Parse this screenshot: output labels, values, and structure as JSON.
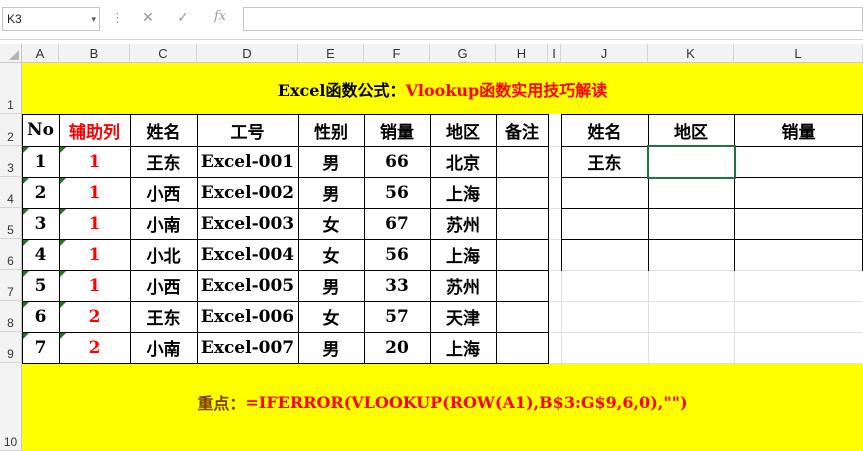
{
  "formula_bar": {
    "name_box": "K3",
    "menu_glyph": "⋮",
    "cancel_glyph": "✕",
    "enter_glyph": "✓",
    "fx_glyph": "fx",
    "dropdown_glyph": "▾"
  },
  "columns": [
    "A",
    "B",
    "C",
    "D",
    "E",
    "F",
    "G",
    "H",
    "I",
    "J",
    "K",
    "L"
  ],
  "rows": [
    "1",
    "2",
    "3",
    "4",
    "5",
    "6",
    "7",
    "8",
    "9",
    "10"
  ],
  "sheet": {
    "title_black": "Excel函数公式：",
    "title_red": "Vlookup函数实用技巧解读",
    "headers": [
      "No",
      "辅助列",
      "姓名",
      "工号",
      "性别",
      "销量",
      "地区",
      "备注"
    ],
    "data": [
      [
        "1",
        "1",
        "王东",
        "Excel-001",
        "男",
        "66",
        "北京",
        ""
      ],
      [
        "2",
        "1",
        "小西",
        "Excel-002",
        "男",
        "56",
        "上海",
        ""
      ],
      [
        "3",
        "1",
        "小南",
        "Excel-003",
        "女",
        "67",
        "苏州",
        ""
      ],
      [
        "4",
        "1",
        "小北",
        "Excel-004",
        "女",
        "56",
        "上海",
        ""
      ],
      [
        "5",
        "1",
        "小西",
        "Excel-005",
        "男",
        "33",
        "苏州",
        ""
      ],
      [
        "6",
        "2",
        "王东",
        "Excel-006",
        "女",
        "57",
        "天津",
        ""
      ],
      [
        "7",
        "2",
        "小南",
        "Excel-007",
        "男",
        "20",
        "上海",
        ""
      ]
    ],
    "lookup_headers": [
      "姓名",
      "地区",
      "销量"
    ],
    "lookup_rows": [
      [
        "王东",
        "",
        ""
      ],
      [
        "",
        "",
        ""
      ],
      [
        "",
        "",
        ""
      ],
      [
        "",
        "",
        ""
      ]
    ],
    "note_label": "重点：",
    "note_formula": "=IFERROR(VLOOKUP(ROW(A1),B$3:G$9,6,0),\"\")"
  },
  "colors": {
    "title_background": "#ffff00",
    "accent_red": "#ff0000",
    "header_fill": "#f3f3f3",
    "gridline": "#e1e1e1"
  }
}
